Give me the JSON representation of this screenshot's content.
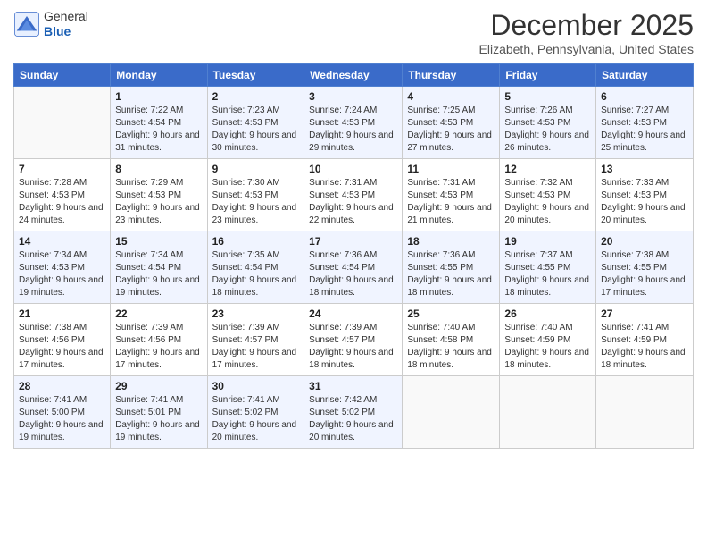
{
  "header": {
    "logo": {
      "general": "General",
      "blue": "Blue"
    },
    "title": "December 2025",
    "location": "Elizabeth, Pennsylvania, United States"
  },
  "weekdays": [
    "Sunday",
    "Monday",
    "Tuesday",
    "Wednesday",
    "Thursday",
    "Friday",
    "Saturday"
  ],
  "weeks": [
    [
      {
        "day": "",
        "sunrise": "",
        "sunset": "",
        "daylight": ""
      },
      {
        "day": "1",
        "sunrise": "Sunrise: 7:22 AM",
        "sunset": "Sunset: 4:54 PM",
        "daylight": "Daylight: 9 hours and 31 minutes."
      },
      {
        "day": "2",
        "sunrise": "Sunrise: 7:23 AM",
        "sunset": "Sunset: 4:53 PM",
        "daylight": "Daylight: 9 hours and 30 minutes."
      },
      {
        "day": "3",
        "sunrise": "Sunrise: 7:24 AM",
        "sunset": "Sunset: 4:53 PM",
        "daylight": "Daylight: 9 hours and 29 minutes."
      },
      {
        "day": "4",
        "sunrise": "Sunrise: 7:25 AM",
        "sunset": "Sunset: 4:53 PM",
        "daylight": "Daylight: 9 hours and 27 minutes."
      },
      {
        "day": "5",
        "sunrise": "Sunrise: 7:26 AM",
        "sunset": "Sunset: 4:53 PM",
        "daylight": "Daylight: 9 hours and 26 minutes."
      },
      {
        "day": "6",
        "sunrise": "Sunrise: 7:27 AM",
        "sunset": "Sunset: 4:53 PM",
        "daylight": "Daylight: 9 hours and 25 minutes."
      }
    ],
    [
      {
        "day": "7",
        "sunrise": "Sunrise: 7:28 AM",
        "sunset": "Sunset: 4:53 PM",
        "daylight": "Daylight: 9 hours and 24 minutes."
      },
      {
        "day": "8",
        "sunrise": "Sunrise: 7:29 AM",
        "sunset": "Sunset: 4:53 PM",
        "daylight": "Daylight: 9 hours and 23 minutes."
      },
      {
        "day": "9",
        "sunrise": "Sunrise: 7:30 AM",
        "sunset": "Sunset: 4:53 PM",
        "daylight": "Daylight: 9 hours and 23 minutes."
      },
      {
        "day": "10",
        "sunrise": "Sunrise: 7:31 AM",
        "sunset": "Sunset: 4:53 PM",
        "daylight": "Daylight: 9 hours and 22 minutes."
      },
      {
        "day": "11",
        "sunrise": "Sunrise: 7:31 AM",
        "sunset": "Sunset: 4:53 PM",
        "daylight": "Daylight: 9 hours and 21 minutes."
      },
      {
        "day": "12",
        "sunrise": "Sunrise: 7:32 AM",
        "sunset": "Sunset: 4:53 PM",
        "daylight": "Daylight: 9 hours and 20 minutes."
      },
      {
        "day": "13",
        "sunrise": "Sunrise: 7:33 AM",
        "sunset": "Sunset: 4:53 PM",
        "daylight": "Daylight: 9 hours and 20 minutes."
      }
    ],
    [
      {
        "day": "14",
        "sunrise": "Sunrise: 7:34 AM",
        "sunset": "Sunset: 4:53 PM",
        "daylight": "Daylight: 9 hours and 19 minutes."
      },
      {
        "day": "15",
        "sunrise": "Sunrise: 7:34 AM",
        "sunset": "Sunset: 4:54 PM",
        "daylight": "Daylight: 9 hours and 19 minutes."
      },
      {
        "day": "16",
        "sunrise": "Sunrise: 7:35 AM",
        "sunset": "Sunset: 4:54 PM",
        "daylight": "Daylight: 9 hours and 18 minutes."
      },
      {
        "day": "17",
        "sunrise": "Sunrise: 7:36 AM",
        "sunset": "Sunset: 4:54 PM",
        "daylight": "Daylight: 9 hours and 18 minutes."
      },
      {
        "day": "18",
        "sunrise": "Sunrise: 7:36 AM",
        "sunset": "Sunset: 4:55 PM",
        "daylight": "Daylight: 9 hours and 18 minutes."
      },
      {
        "day": "19",
        "sunrise": "Sunrise: 7:37 AM",
        "sunset": "Sunset: 4:55 PM",
        "daylight": "Daylight: 9 hours and 18 minutes."
      },
      {
        "day": "20",
        "sunrise": "Sunrise: 7:38 AM",
        "sunset": "Sunset: 4:55 PM",
        "daylight": "Daylight: 9 hours and 17 minutes."
      }
    ],
    [
      {
        "day": "21",
        "sunrise": "Sunrise: 7:38 AM",
        "sunset": "Sunset: 4:56 PM",
        "daylight": "Daylight: 9 hours and 17 minutes."
      },
      {
        "day": "22",
        "sunrise": "Sunrise: 7:39 AM",
        "sunset": "Sunset: 4:56 PM",
        "daylight": "Daylight: 9 hours and 17 minutes."
      },
      {
        "day": "23",
        "sunrise": "Sunrise: 7:39 AM",
        "sunset": "Sunset: 4:57 PM",
        "daylight": "Daylight: 9 hours and 17 minutes."
      },
      {
        "day": "24",
        "sunrise": "Sunrise: 7:39 AM",
        "sunset": "Sunset: 4:57 PM",
        "daylight": "Daylight: 9 hours and 18 minutes."
      },
      {
        "day": "25",
        "sunrise": "Sunrise: 7:40 AM",
        "sunset": "Sunset: 4:58 PM",
        "daylight": "Daylight: 9 hours and 18 minutes."
      },
      {
        "day": "26",
        "sunrise": "Sunrise: 7:40 AM",
        "sunset": "Sunset: 4:59 PM",
        "daylight": "Daylight: 9 hours and 18 minutes."
      },
      {
        "day": "27",
        "sunrise": "Sunrise: 7:41 AM",
        "sunset": "Sunset: 4:59 PM",
        "daylight": "Daylight: 9 hours and 18 minutes."
      }
    ],
    [
      {
        "day": "28",
        "sunrise": "Sunrise: 7:41 AM",
        "sunset": "Sunset: 5:00 PM",
        "daylight": "Daylight: 9 hours and 19 minutes."
      },
      {
        "day": "29",
        "sunrise": "Sunrise: 7:41 AM",
        "sunset": "Sunset: 5:01 PM",
        "daylight": "Daylight: 9 hours and 19 minutes."
      },
      {
        "day": "30",
        "sunrise": "Sunrise: 7:41 AM",
        "sunset": "Sunset: 5:02 PM",
        "daylight": "Daylight: 9 hours and 20 minutes."
      },
      {
        "day": "31",
        "sunrise": "Sunrise: 7:42 AM",
        "sunset": "Sunset: 5:02 PM",
        "daylight": "Daylight: 9 hours and 20 minutes."
      },
      {
        "day": "",
        "sunrise": "",
        "sunset": "",
        "daylight": ""
      },
      {
        "day": "",
        "sunrise": "",
        "sunset": "",
        "daylight": ""
      },
      {
        "day": "",
        "sunrise": "",
        "sunset": "",
        "daylight": ""
      }
    ]
  ]
}
